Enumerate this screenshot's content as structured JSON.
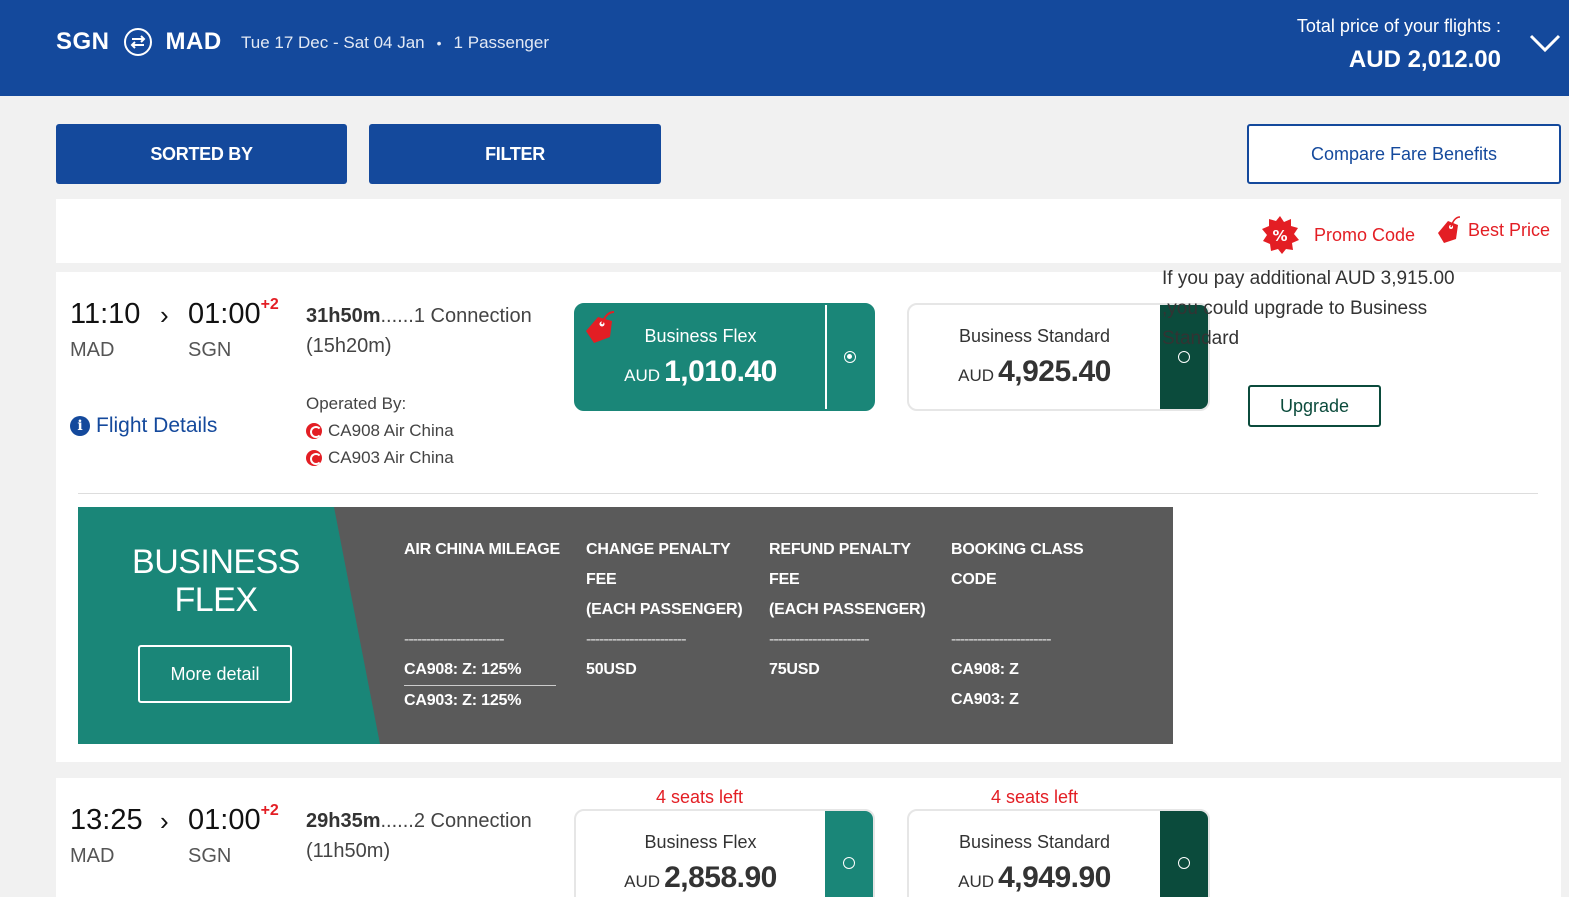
{
  "header": {
    "origin": "SGN",
    "destination": "MAD",
    "dates": "Tue 17 Dec - Sat 04 Jan",
    "passengers": "1 Passenger",
    "total_label": "Total price of your flights :",
    "total_amount": "AUD 2,012.00"
  },
  "toolbar": {
    "sorted_by": "SORTED BY",
    "filter": "FILTER",
    "compare": "Compare Fare Benefits"
  },
  "legend": {
    "promo": "Promo Code",
    "best_price": "Best Price"
  },
  "flights": [
    {
      "dep_time": "11:10",
      "arr_time": "01:00",
      "day_offset": "+2",
      "dep_airport": "MAD",
      "arr_airport": "SGN",
      "duration": "31h50m",
      "connection": "......1 Connection",
      "layover": "(15h20m)",
      "details_link": "Flight Details",
      "operated_label": "Operated By:",
      "operators": [
        "CA908 Air China",
        "CA903 Air China"
      ],
      "fares": [
        {
          "name": "Business Flex",
          "currency": "AUD",
          "amount": "1,010.40"
        },
        {
          "name": "Business Standard",
          "currency": "AUD",
          "amount": "4,925.40"
        }
      ]
    },
    {
      "dep_time": "13:25",
      "arr_time": "01:00",
      "day_offset": "+2",
      "dep_airport": "MAD",
      "arr_airport": "SGN",
      "duration": "29h35m",
      "connection": "......2 Connection",
      "layover": "(11h50m)",
      "fares": [
        {
          "name": "Business Flex",
          "currency": "AUD",
          "amount": "2,858.90",
          "seats_left": "4 seats left"
        },
        {
          "name": "Business Standard",
          "currency": "AUD",
          "amount": "4,949.90",
          "seats_left": "4 seats left"
        }
      ]
    }
  ],
  "fare_detail": {
    "title_line1": "BUSINESS",
    "title_line2": "FLEX",
    "more_detail": "More detail",
    "separator": "-----------------------",
    "mileage": {
      "header": "AIR CHINA MILEAGE",
      "values": [
        "CA908: Z: 125%",
        "CA903: Z: 125%"
      ]
    },
    "change": {
      "header1": "CHANGE PENALTY",
      "header2": "FEE",
      "header3": "(EACH PASSENGER)",
      "value": "50USD"
    },
    "refund": {
      "header1": "REFUND PENALTY",
      "header2": "FEE",
      "header3": "(EACH PASSENGER)",
      "value": "75USD"
    },
    "booking": {
      "header1": "BOOKING CLASS",
      "header2": "CODE",
      "values": [
        "CA908: Z",
        "CA903: Z"
      ]
    },
    "upgrade_text": "If you pay additional AUD 3,915.00 ,you could upgrade to Business Standard",
    "upgrade_button": "Upgrade"
  },
  "colors": {
    "brand_blue": "#14499c",
    "fare_green": "#1a8678",
    "fare_dark_green": "#0b4b3c",
    "promo_red": "#e31e24",
    "panel_grey": "#5a5a5a"
  }
}
